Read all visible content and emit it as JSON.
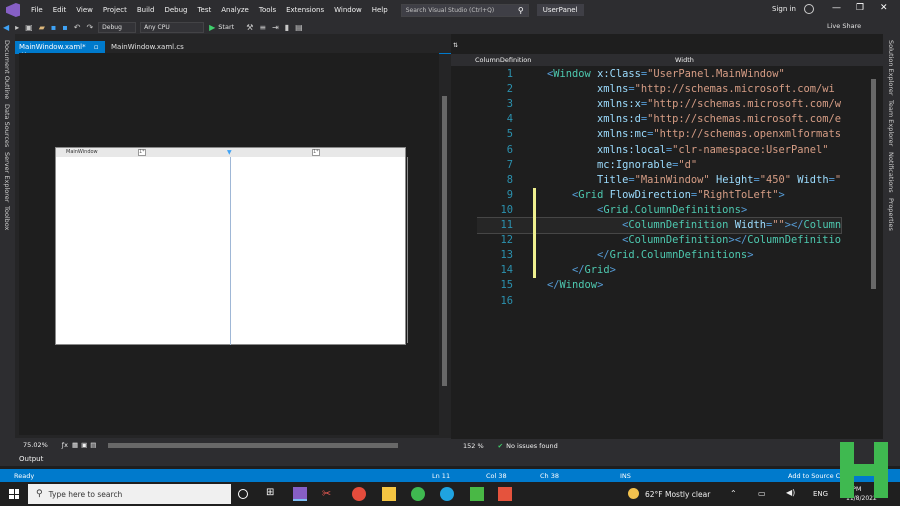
{
  "menu": [
    "File",
    "Edit",
    "View",
    "Project",
    "Build",
    "Debug",
    "Test",
    "Analyze",
    "Tools",
    "Extensions",
    "Window",
    "Help"
  ],
  "search": {
    "placeholder": "Search Visual Studio (Ctrl+Q)"
  },
  "project_name": "UserPanel",
  "signin": "Sign in",
  "live_share": "Live Share",
  "toolbar": {
    "config": "Debug",
    "platform": "Any CPU",
    "start": "Start"
  },
  "left_rail": [
    "Document Outline",
    "Data Sources",
    "Server Explorer",
    "Toolbox"
  ],
  "right_rail": [
    "Solution Explorer",
    "Team Explorer",
    "Notifications",
    "Properties"
  ],
  "tabs": {
    "xaml": "MainWindow.xaml*",
    "cs": "MainWindow.xaml.cs"
  },
  "designer": {
    "window_title": "MainWindow",
    "zoom": "75.02%"
  },
  "editor": {
    "nav_left": "ColumnDefinition",
    "nav_right": "Width",
    "zoom": "152 %",
    "issues": "No issues found"
  },
  "code_lines": [
    {
      "n": "1",
      "text": "<Window x:Class=\"UserPanel.MainWindow\""
    },
    {
      "n": "2",
      "text": "        xmlns=\"http://schemas.microsoft.com/wi"
    },
    {
      "n": "3",
      "text": "        xmlns:x=\"http://schemas.microsoft.com/w"
    },
    {
      "n": "4",
      "text": "        xmlns:d=\"http://schemas.microsoft.com/e"
    },
    {
      "n": "5",
      "text": "        xmlns:mc=\"http://schemas.openxmlformats"
    },
    {
      "n": "6",
      "text": "        xmlns:local=\"clr-namespace:UserPanel\""
    },
    {
      "n": "7",
      "text": "        mc:Ignorable=\"d\""
    },
    {
      "n": "8",
      "text": "        Title=\"MainWindow\" Height=\"450\" Width=\""
    },
    {
      "n": "9",
      "text": "    <Grid FlowDirection=\"RightToLeft\">"
    },
    {
      "n": "10",
      "text": "        <Grid.ColumnDefinitions>"
    },
    {
      "n": "11",
      "text": "            <ColumnDefinition Width=\"\"></Column"
    },
    {
      "n": "12",
      "text": "            <ColumnDefinition></ColumnDefinitio"
    },
    {
      "n": "13",
      "text": "        </Grid.ColumnDefinitions>"
    },
    {
      "n": "14",
      "text": "    </Grid>"
    },
    {
      "n": "15",
      "text": "</Window>"
    },
    {
      "n": "16",
      "text": ""
    }
  ],
  "output_label": "Output",
  "status": {
    "ready": "Ready",
    "ln": "Ln 11",
    "col": "Col 38",
    "ch": "Ch 38",
    "ins": "INS",
    "source_control": "Add to Source Co..."
  },
  "taskbar": {
    "search": "Type here to search",
    "weather": "62°F  Mostly clear",
    "lang": "ENG",
    "time": "PM",
    "date": "11/8/2022"
  }
}
